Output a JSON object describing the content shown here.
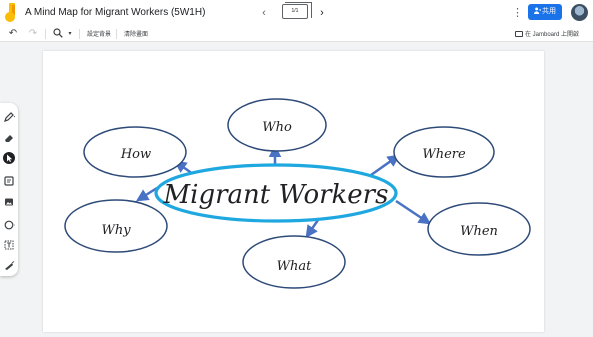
{
  "app": {
    "title": "A Mind Map for Migrant Workers (5W1H)",
    "frame_indicator": "1/1",
    "share_label": "共用"
  },
  "toolbar": {
    "set_background": "設定背景",
    "clear_frame": "清除畫面",
    "open_in_jamboard": "在 Jamboard 上開啟"
  },
  "mindmap": {
    "center": "Migrant Workers",
    "nodes": [
      "Who",
      "Where",
      "When",
      "What",
      "Why",
      "How"
    ]
  },
  "colors": {
    "center_outline": "#1fa8e0",
    "node_outline": "#2d4a78",
    "arrow": "#4a72c4",
    "accent_blue": "#1a73e8",
    "logo_yellow": "#fbbc04"
  },
  "icons": {
    "side_tools": [
      "pen-icon",
      "eraser-icon",
      "select-cursor-icon",
      "sticky-note-icon",
      "image-icon",
      "circle-shape-icon",
      "text-box-icon",
      "laser-icon"
    ]
  }
}
